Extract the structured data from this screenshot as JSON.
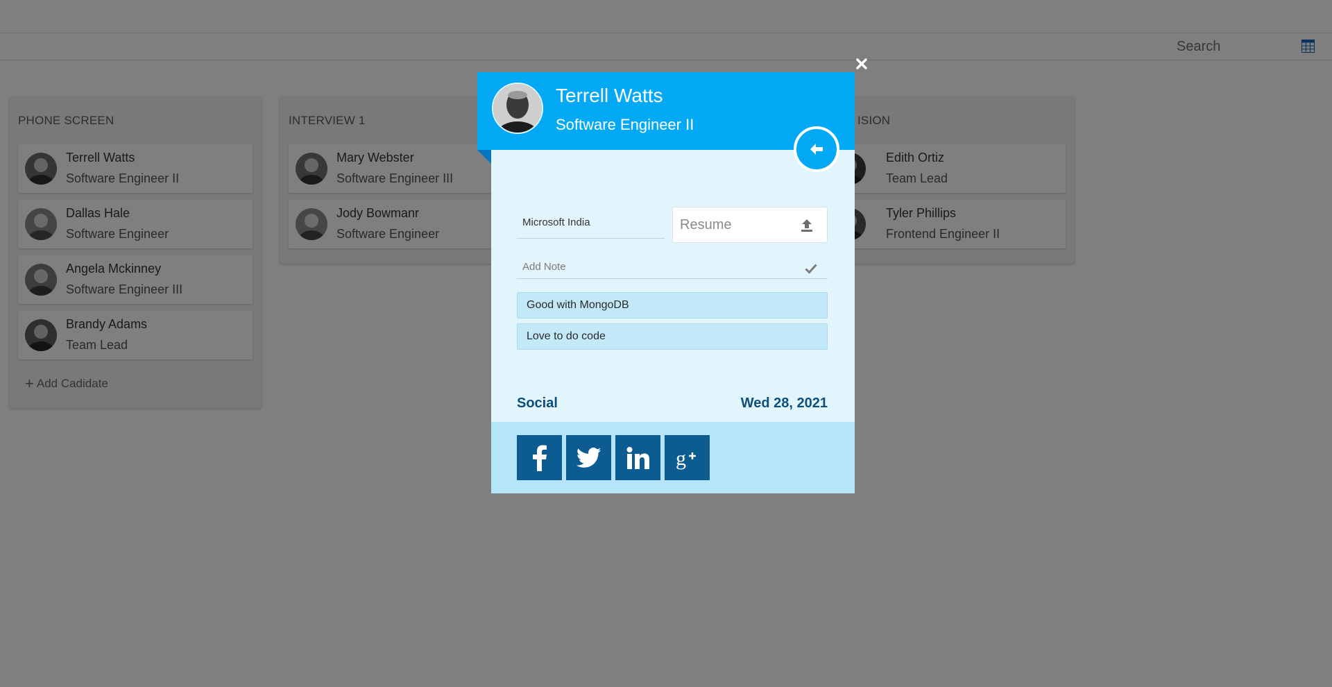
{
  "toolbar": {
    "search_placeholder": "Search",
    "calendar_icon": "calendar-grid-icon"
  },
  "board": {
    "columns": [
      {
        "title": "PHONE SCREEN",
        "cards": [
          {
            "name": "Terrell Watts",
            "role": "Software Engineer II"
          },
          {
            "name": "Dallas Hale",
            "role": "Software Engineer"
          },
          {
            "name": "Angela Mckinney",
            "role": "Software Engineer III"
          },
          {
            "name": "Brandy Adams",
            "role": "Team Lead"
          }
        ],
        "add_label": "Add Cadidate"
      },
      {
        "title": "INTERVIEW 1",
        "cards": [
          {
            "name": "Mary Webster",
            "role": "Software Engineer III"
          },
          {
            "name": "Jody Bowmanr",
            "role": "Software Engineer"
          }
        ]
      },
      {
        "title": "ISION",
        "cards": [
          {
            "name": "Edith Ortiz",
            "role": "Team Lead"
          },
          {
            "name": "Tyler Phillips",
            "role": "Frontend Engineer II"
          }
        ]
      }
    ]
  },
  "modal": {
    "name": "Terrell Watts",
    "role": "Software Engineer II",
    "company_value": "Microsoft India",
    "resume_label": "Resume",
    "note_placeholder": "Add Note",
    "notes": [
      "Good with MongoDB",
      "Love to do code"
    ],
    "social_label": "Social",
    "date": "Wed 28, 2021",
    "social_icons": [
      "facebook-icon",
      "twitter-icon",
      "linkedin-icon",
      "google-plus-icon"
    ],
    "colors": {
      "header": "#03a9f4",
      "body": "#e2f5fd",
      "social_bar": "#b6e4f9",
      "social_button": "#0d5c91",
      "accent_text": "#0d4e7b"
    }
  }
}
